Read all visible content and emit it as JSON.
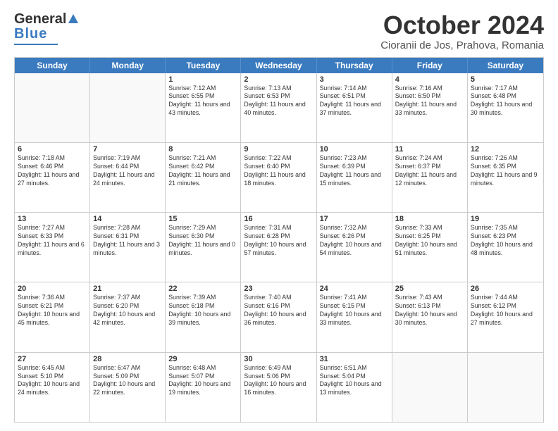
{
  "header": {
    "logo_general": "General",
    "logo_blue": "Blue",
    "month": "October 2024",
    "location": "Cioranii de Jos, Prahova, Romania"
  },
  "weekdays": [
    "Sunday",
    "Monday",
    "Tuesday",
    "Wednesday",
    "Thursday",
    "Friday",
    "Saturday"
  ],
  "rows": [
    [
      {
        "day": "",
        "text": "",
        "empty": true
      },
      {
        "day": "",
        "text": "",
        "empty": true
      },
      {
        "day": "1",
        "text": "Sunrise: 7:12 AM\nSunset: 6:55 PM\nDaylight: 11 hours and 43 minutes."
      },
      {
        "day": "2",
        "text": "Sunrise: 7:13 AM\nSunset: 6:53 PM\nDaylight: 11 hours and 40 minutes."
      },
      {
        "day": "3",
        "text": "Sunrise: 7:14 AM\nSunset: 6:51 PM\nDaylight: 11 hours and 37 minutes."
      },
      {
        "day": "4",
        "text": "Sunrise: 7:16 AM\nSunset: 6:50 PM\nDaylight: 11 hours and 33 minutes."
      },
      {
        "day": "5",
        "text": "Sunrise: 7:17 AM\nSunset: 6:48 PM\nDaylight: 11 hours and 30 minutes."
      }
    ],
    [
      {
        "day": "6",
        "text": "Sunrise: 7:18 AM\nSunset: 6:46 PM\nDaylight: 11 hours and 27 minutes."
      },
      {
        "day": "7",
        "text": "Sunrise: 7:19 AM\nSunset: 6:44 PM\nDaylight: 11 hours and 24 minutes."
      },
      {
        "day": "8",
        "text": "Sunrise: 7:21 AM\nSunset: 6:42 PM\nDaylight: 11 hours and 21 minutes."
      },
      {
        "day": "9",
        "text": "Sunrise: 7:22 AM\nSunset: 6:40 PM\nDaylight: 11 hours and 18 minutes."
      },
      {
        "day": "10",
        "text": "Sunrise: 7:23 AM\nSunset: 6:39 PM\nDaylight: 11 hours and 15 minutes."
      },
      {
        "day": "11",
        "text": "Sunrise: 7:24 AM\nSunset: 6:37 PM\nDaylight: 11 hours and 12 minutes."
      },
      {
        "day": "12",
        "text": "Sunrise: 7:26 AM\nSunset: 6:35 PM\nDaylight: 11 hours and 9 minutes."
      }
    ],
    [
      {
        "day": "13",
        "text": "Sunrise: 7:27 AM\nSunset: 6:33 PM\nDaylight: 11 hours and 6 minutes."
      },
      {
        "day": "14",
        "text": "Sunrise: 7:28 AM\nSunset: 6:31 PM\nDaylight: 11 hours and 3 minutes."
      },
      {
        "day": "15",
        "text": "Sunrise: 7:29 AM\nSunset: 6:30 PM\nDaylight: 11 hours and 0 minutes."
      },
      {
        "day": "16",
        "text": "Sunrise: 7:31 AM\nSunset: 6:28 PM\nDaylight: 10 hours and 57 minutes."
      },
      {
        "day": "17",
        "text": "Sunrise: 7:32 AM\nSunset: 6:26 PM\nDaylight: 10 hours and 54 minutes."
      },
      {
        "day": "18",
        "text": "Sunrise: 7:33 AM\nSunset: 6:25 PM\nDaylight: 10 hours and 51 minutes."
      },
      {
        "day": "19",
        "text": "Sunrise: 7:35 AM\nSunset: 6:23 PM\nDaylight: 10 hours and 48 minutes."
      }
    ],
    [
      {
        "day": "20",
        "text": "Sunrise: 7:36 AM\nSunset: 6:21 PM\nDaylight: 10 hours and 45 minutes."
      },
      {
        "day": "21",
        "text": "Sunrise: 7:37 AM\nSunset: 6:20 PM\nDaylight: 10 hours and 42 minutes."
      },
      {
        "day": "22",
        "text": "Sunrise: 7:39 AM\nSunset: 6:18 PM\nDaylight: 10 hours and 39 minutes."
      },
      {
        "day": "23",
        "text": "Sunrise: 7:40 AM\nSunset: 6:16 PM\nDaylight: 10 hours and 36 minutes."
      },
      {
        "day": "24",
        "text": "Sunrise: 7:41 AM\nSunset: 6:15 PM\nDaylight: 10 hours and 33 minutes."
      },
      {
        "day": "25",
        "text": "Sunrise: 7:43 AM\nSunset: 6:13 PM\nDaylight: 10 hours and 30 minutes."
      },
      {
        "day": "26",
        "text": "Sunrise: 7:44 AM\nSunset: 6:12 PM\nDaylight: 10 hours and 27 minutes."
      }
    ],
    [
      {
        "day": "27",
        "text": "Sunrise: 6:45 AM\nSunset: 5:10 PM\nDaylight: 10 hours and 24 minutes."
      },
      {
        "day": "28",
        "text": "Sunrise: 6:47 AM\nSunset: 5:09 PM\nDaylight: 10 hours and 22 minutes."
      },
      {
        "day": "29",
        "text": "Sunrise: 6:48 AM\nSunset: 5:07 PM\nDaylight: 10 hours and 19 minutes."
      },
      {
        "day": "30",
        "text": "Sunrise: 6:49 AM\nSunset: 5:06 PM\nDaylight: 10 hours and 16 minutes."
      },
      {
        "day": "31",
        "text": "Sunrise: 6:51 AM\nSunset: 5:04 PM\nDaylight: 10 hours and 13 minutes."
      },
      {
        "day": "",
        "text": "",
        "empty": true
      },
      {
        "day": "",
        "text": "",
        "empty": true
      }
    ]
  ]
}
